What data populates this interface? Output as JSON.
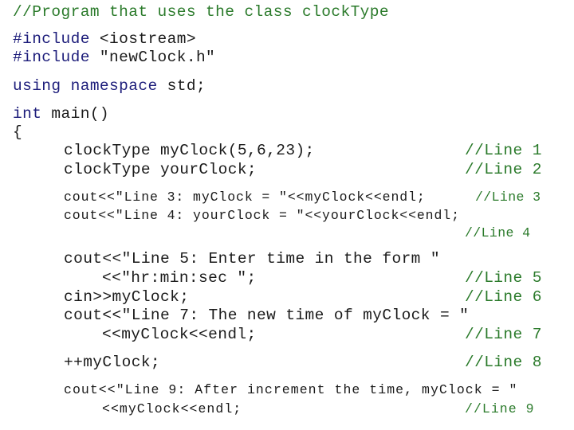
{
  "header_comment": "//Program that uses the class clockType",
  "includes": [
    {
      "directive": "#include",
      "target": " <iostream>"
    },
    {
      "directive": "#include",
      "target": " \"newClock.h\""
    }
  ],
  "using": {
    "kw1": "using",
    "kw2": "namespace",
    "rest": " std;"
  },
  "main_sig": {
    "kw": "int",
    "rest": " main()"
  },
  "open_brace": "{",
  "lines": [
    {
      "code": "clockType myClock(5,6,23);",
      "comment": "//Line 1"
    },
    {
      "code": "clockType yourClock;",
      "comment": "//Line 2"
    },
    {
      "code": "cout<<\"Line 3: myClock = \"<<myClock<<endl;",
      "comment": "//Line 3"
    },
    {
      "code": "cout<<\"Line 4: yourClock = \"<<yourClock<<endl;",
      "comment": "//Line 4"
    },
    {
      "code": "cout<<\"Line 5: Enter time in the form \"",
      "code2": "<<\"hr:min:sec \";",
      "comment": "//Line 5"
    },
    {
      "code": "cin>>myClock;",
      "comment": "//Line 6"
    },
    {
      "code": "cout<<\"Line 7: The new time of myClock = \"",
      "code2": "<<myClock<<endl;",
      "comment": "//Line 7"
    },
    {
      "code": "++myClock;",
      "comment": "//Line 8"
    },
    {
      "code": "cout<<\"Line 9: After increment the time, myClock = \"",
      "code2": "<<myClock<<endl;",
      "comment": "//Line 9"
    }
  ],
  "colors": {
    "keyword": "#1c1c7a",
    "comment": "#2a7a2a",
    "text": "#1a1a1a"
  }
}
